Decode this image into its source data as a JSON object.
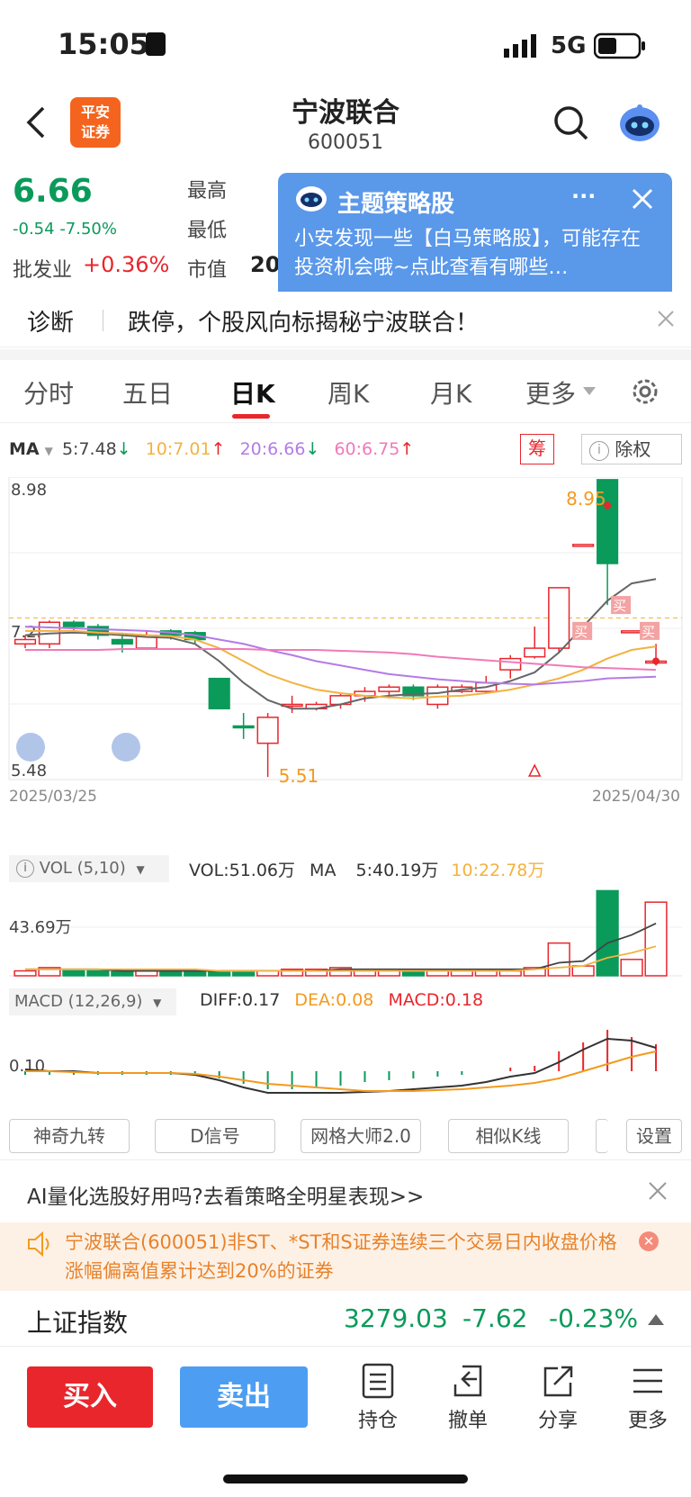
{
  "status_bar": {
    "time": "15:05",
    "network": "5G"
  },
  "header": {
    "title": "宁波联合",
    "code": "600051",
    "brand": "平安\n证券"
  },
  "quote": {
    "price": "6.66",
    "change": "-0.54",
    "change_pct": "-7.50%",
    "high_label": "最高",
    "low_label": "最低",
    "mktcap_label": "市值",
    "mktcap_value": "20",
    "sector_label": "批发业",
    "sector_pct": "+0.36%"
  },
  "popup": {
    "title": "主题策略股",
    "more": "···",
    "text": "小安发现一些【白马策略股】，可能存在投资机会哦~点此查看有哪些…"
  },
  "diagnosis": {
    "label": "诊断",
    "text": "跌停，个股风向标揭秘宁波联合！"
  },
  "tabs": [
    "分时",
    "五日",
    "日K",
    "周K",
    "月K",
    "更多"
  ],
  "active_tab": "日K",
  "ma_line": {
    "label": "MA",
    "ma5": "5:7.48",
    "ma10": "10:7.01",
    "ma20": "20:6.66",
    "ma60": "60:6.75",
    "chip_btn": "筹",
    "rights_btn": "除权"
  },
  "chart_data": [
    {
      "type": "candlestick",
      "y_labels": [
        "8.98",
        "7.23",
        "5.48"
      ],
      "x_labels": [
        "2025/03/25",
        "2025/04/30"
      ],
      "annotations": [
        "8.95",
        "5.51",
        "买",
        "买",
        "买"
      ],
      "ylim": [
        5.48,
        8.98
      ],
      "candles": [
        {
          "o": 7.05,
          "c": 7.1,
          "h": 7.15,
          "l": 7.0
        },
        {
          "o": 7.05,
          "c": 7.3,
          "h": 7.32,
          "l": 7.0
        },
        {
          "o": 7.3,
          "c": 7.25,
          "h": 7.32,
          "l": 7.2
        },
        {
          "o": 7.25,
          "c": 7.15,
          "h": 7.28,
          "l": 7.1
        },
        {
          "o": 7.1,
          "c": 7.05,
          "h": 7.18,
          "l": 6.95
        },
        {
          "o": 7.0,
          "c": 7.15,
          "h": 7.2,
          "l": 6.98
        },
        {
          "o": 7.2,
          "c": 7.15,
          "h": 7.22,
          "l": 7.1
        },
        {
          "o": 7.18,
          "c": 7.1,
          "h": 7.2,
          "l": 7.05
        },
        {
          "o": 6.65,
          "c": 6.3,
          "h": 6.65,
          "l": 6.3
        },
        {
          "o": 6.1,
          "c": 6.08,
          "h": 6.25,
          "l": 5.95
        },
        {
          "o": 5.9,
          "c": 6.2,
          "h": 6.25,
          "l": 5.51
        },
        {
          "o": 6.35,
          "c": 6.35,
          "h": 6.45,
          "l": 6.25
        },
        {
          "o": 6.3,
          "c": 6.35,
          "h": 6.38,
          "l": 6.28
        },
        {
          "o": 6.35,
          "c": 6.45,
          "h": 6.48,
          "l": 6.3
        },
        {
          "o": 6.45,
          "c": 6.5,
          "h": 6.55,
          "l": 6.38
        },
        {
          "o": 6.5,
          "c": 6.55,
          "h": 6.58,
          "l": 6.42
        },
        {
          "o": 6.55,
          "c": 6.45,
          "h": 6.58,
          "l": 6.4
        },
        {
          "o": 6.35,
          "c": 6.55,
          "h": 6.58,
          "l": 6.3
        },
        {
          "o": 6.5,
          "c": 6.55,
          "h": 6.58,
          "l": 6.48
        },
        {
          "o": 6.5,
          "c": 6.6,
          "h": 6.68,
          "l": 6.48
        },
        {
          "o": 6.75,
          "c": 6.88,
          "h": 6.92,
          "l": 6.65
        },
        {
          "o": 6.9,
          "c": 7.0,
          "h": 7.25,
          "l": 6.88
        },
        {
          "o": 7.0,
          "c": 7.7,
          "h": 7.7,
          "l": 6.95
        },
        {
          "o": 8.2,
          "c": 8.2,
          "h": 8.2,
          "l": 8.2
        },
        {
          "o": 8.95,
          "c": 7.98,
          "h": 8.95,
          "l": 7.5
        },
        {
          "o": 7.2,
          "c": 7.2,
          "h": 7.2,
          "l": 7.2
        },
        {
          "o": 6.85,
          "c": 6.85,
          "h": 7.05,
          "l": 6.8
        }
      ],
      "ma_series": [
        {
          "name": "MA5",
          "color": "#666666"
        },
        {
          "name": "MA10",
          "color": "#f3b23f"
        },
        {
          "name": "MA20",
          "color": "#b57be6"
        },
        {
          "name": "MA60",
          "color": "#f07ab8"
        }
      ]
    },
    {
      "type": "bar",
      "label": "VOL (5,10)",
      "y_label": "43.69万",
      "vol_value": "VOL:51.06万",
      "ma_label": "MA",
      "ma5": "5:40.19万",
      "ma10": "10:22.78万",
      "values": [
        3,
        5,
        3,
        3,
        3,
        3,
        3,
        3,
        3,
        3,
        3,
        4,
        4,
        5,
        4,
        4,
        3,
        3,
        3,
        3,
        3,
        5,
        20,
        6,
        52,
        10,
        45
      ]
    },
    {
      "type": "bar",
      "label": "MACD (12,26,9)",
      "y_label": "0.10",
      "diff": "DIFF:0.17",
      "dea": "DEA:0.08",
      "macd": "MACD:0.18"
    }
  ],
  "toolbar": [
    "神奇九转",
    "D信号",
    "网格大师2.0",
    "相似K线",
    "设置"
  ],
  "ad": {
    "text": "AI量化选股好用吗?去看策略全明星表现>>"
  },
  "notice": {
    "text": "宁波联合(600051)非ST、*ST和S证券连续三个交易日内收盘价格涨幅偏离值累计达到20%的证券"
  },
  "index": {
    "name": "上证指数",
    "value": "3279.03",
    "change": "-7.62",
    "pct": "-0.23%"
  },
  "actions": {
    "buy": "买入",
    "sell": "卖出",
    "hold": "持仓",
    "cancel": "撤单",
    "share": "分享",
    "more": "更多"
  }
}
